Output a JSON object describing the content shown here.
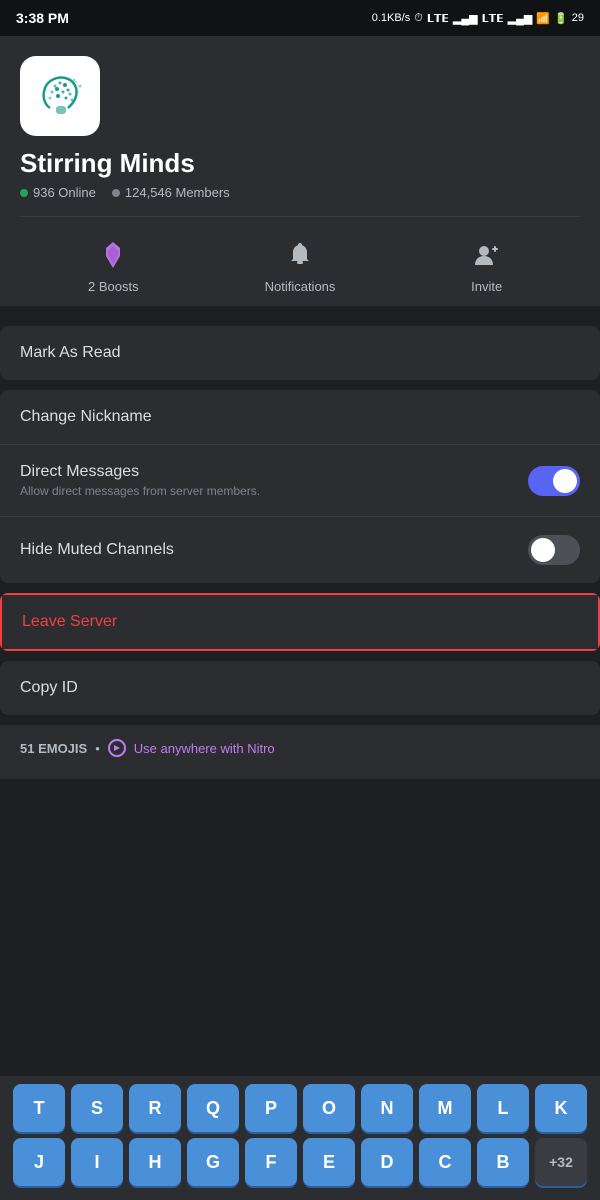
{
  "statusBar": {
    "time": "3:38 PM",
    "speed": "0.1KB/s",
    "battery": "29"
  },
  "server": {
    "name": "Stirring Minds",
    "online": "936 Online",
    "members": "124,546 Members",
    "iconAlt": "Stirring Minds server icon"
  },
  "actions": {
    "boosts": {
      "label": "2 Boosts",
      "icon": "boost-icon"
    },
    "notifications": {
      "label": "Notifications",
      "icon": "bell-icon"
    },
    "invite": {
      "label": "Invite",
      "icon": "invite-icon"
    }
  },
  "menu": {
    "markAsRead": "Mark As Read",
    "changeNickname": "Change Nickname",
    "directMessages": {
      "label": "Direct Messages",
      "sublabel": "Allow direct messages from server members.",
      "enabled": true
    },
    "hideMutedChannels": {
      "label": "Hide Muted Channels",
      "enabled": false
    },
    "leaveServer": "Leave Server",
    "copyId": "Copy ID"
  },
  "emojis": {
    "count": "51 EMOJIS",
    "nitroText": "Use anywhere with Nitro"
  },
  "keyboard": {
    "row1": [
      "T",
      "S",
      "R",
      "Q",
      "P",
      "O",
      "N",
      "M",
      "L",
      "K"
    ],
    "row2": [
      "J",
      "I",
      "H",
      "G",
      "F",
      "E",
      "D",
      "C",
      "B",
      "+32"
    ]
  }
}
